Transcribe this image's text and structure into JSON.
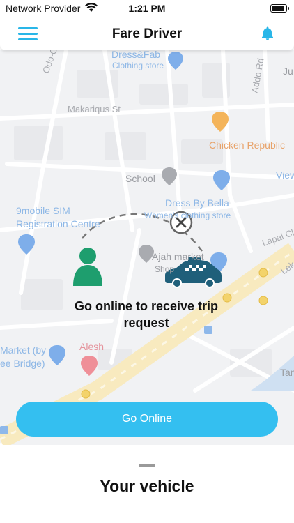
{
  "status_bar": {
    "carrier": "Network Provider",
    "time": "1:21 PM",
    "battery_level": 0.95
  },
  "header": {
    "title": "Fare Driver",
    "menu_icon": "hamburger-menu-icon",
    "notification_icon": "bell-icon"
  },
  "map": {
    "labels": {
      "dress_fab": "Dress&Fab",
      "clothing_store_1": "Clothing store",
      "odo_o": "Odo-O",
      "addo_rd": "Addo Rd",
      "ju": "Ju",
      "makariqus_st": "Makariqus St",
      "chicken_republic": "Chicken Republic",
      "school": "School",
      "view": "View",
      "dress_by_bella": "Dress By Bella",
      "womens_clothing_store": "Women's clothing store",
      "nine_mobile_1": "9mobile SIM",
      "nine_mobile_2": "Registration Centre",
      "lapai": "Lapai Cl",
      "ajah_market": "Ajah market",
      "shop": "Shop",
      "lek": "Lek",
      "market_by_1": "Market (by",
      "market_by_2": "ee Bridge)",
      "alesh": "Alesh",
      "tan": "Tan"
    },
    "colors": {
      "background": "#f1f2f4",
      "road": "#ffffff",
      "highway": "#f8eabf",
      "brand_blue": "#34bff0",
      "driver_green": "#1e9e6e",
      "car_teal": "#1f5f7a"
    }
  },
  "overlay": {
    "message": "Go online to receive trip request",
    "driver_icon": "person-icon",
    "car_icon": "taxi-icon",
    "disconnect_icon": "close-circle-icon"
  },
  "actions": {
    "go_online_label": "Go Online"
  },
  "sheet": {
    "title": "Your vehicle"
  }
}
